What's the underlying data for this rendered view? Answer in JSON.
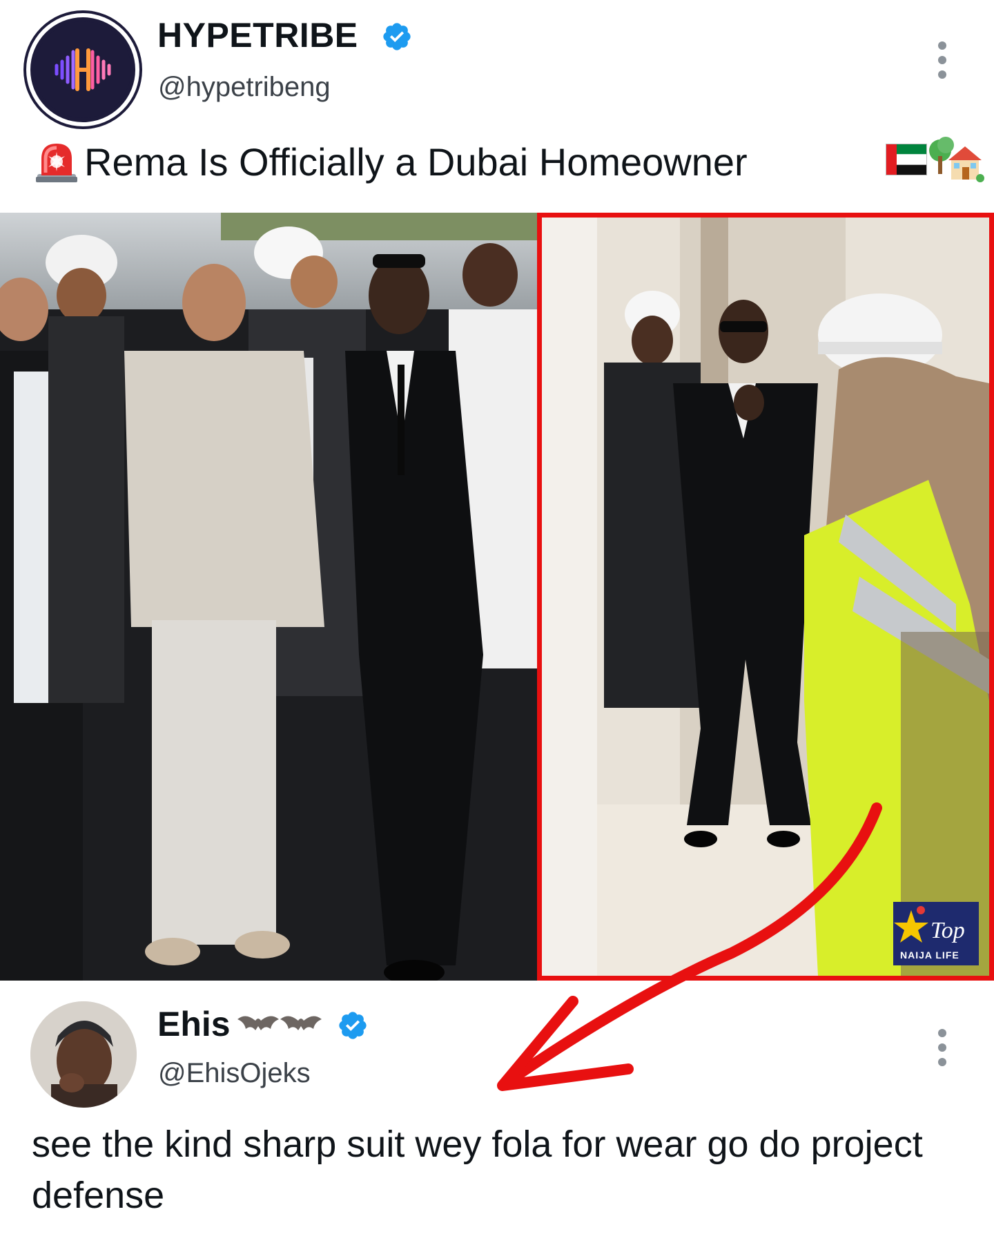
{
  "post": {
    "author_name": "HYPETRIBE",
    "author_handle": "@hypetribeng",
    "text": "Rema Is Officially a Dubai Homeowner",
    "siren_icon": "police-car-light-emoji",
    "flag_icon": "uae-flag-emoji",
    "house_icon": "house-with-garden-emoji",
    "verified_color": "#1d9bf0"
  },
  "media": {
    "highlight_border_color": "#e81010",
    "watermark": {
      "line1": "Top",
      "line2": "NAIJA LIFE"
    }
  },
  "reply": {
    "author_name": "Ehis",
    "name_decoration_icon": "bat-emoji",
    "author_handle": "@EhisOjeks",
    "text": "see the kind sharp suit wey fola for wear go do project defense"
  },
  "annotation": {
    "arrow_color": "#e81010"
  }
}
